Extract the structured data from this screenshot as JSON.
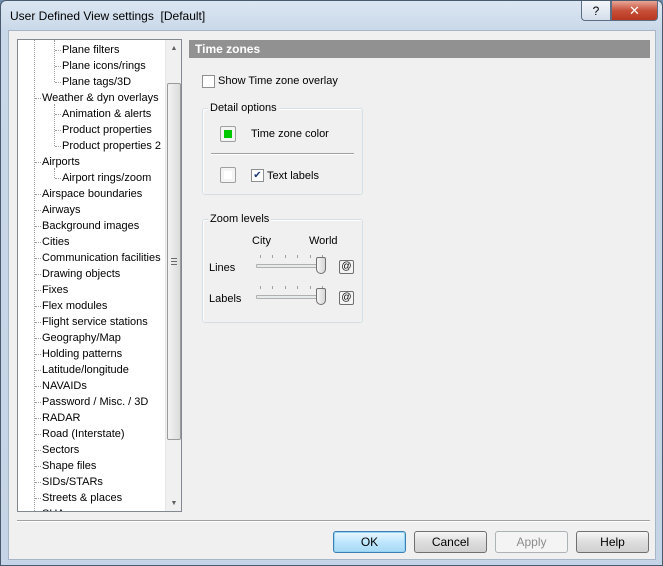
{
  "window": {
    "title": "User Defined View settings  [Default]",
    "help_label": "?",
    "close_label": "✕"
  },
  "tree": {
    "items": [
      {
        "label": "Plane filters",
        "level": 2
      },
      {
        "label": "Plane icons/rings",
        "level": 2
      },
      {
        "label": "Plane tags/3D",
        "level": 2
      },
      {
        "label": "Weather & dyn overlays",
        "level": 1
      },
      {
        "label": "Animation & alerts",
        "level": 2
      },
      {
        "label": "Product properties",
        "level": 2
      },
      {
        "label": "Product properties 2",
        "level": 2
      },
      {
        "label": "Airports",
        "level": 1
      },
      {
        "label": "Airport rings/zoom",
        "level": 2
      },
      {
        "label": "Airspace boundaries",
        "level": 1
      },
      {
        "label": "Airways",
        "level": 1
      },
      {
        "label": "Background images",
        "level": 1
      },
      {
        "label": "Cities",
        "level": 1
      },
      {
        "label": "Communication facilities",
        "level": 1
      },
      {
        "label": "Drawing objects",
        "level": 1
      },
      {
        "label": "Fixes",
        "level": 1
      },
      {
        "label": "Flex modules",
        "level": 1
      },
      {
        "label": "Flight service stations",
        "level": 1
      },
      {
        "label": "Geography/Map",
        "level": 1
      },
      {
        "label": "Holding patterns",
        "level": 1
      },
      {
        "label": "Latitude/longitude",
        "level": 1
      },
      {
        "label": "NAVAIDs",
        "level": 1
      },
      {
        "label": "Password / Misc. / 3D",
        "level": 1
      },
      {
        "label": "RADAR",
        "level": 1
      },
      {
        "label": "Road (Interstate)",
        "level": 1
      },
      {
        "label": "Sectors",
        "level": 1
      },
      {
        "label": "Shape files",
        "level": 1
      },
      {
        "label": "SIDs/STARs",
        "level": 1
      },
      {
        "label": "Streets & places",
        "level": 1
      },
      {
        "label": "SUAs",
        "level": 1
      }
    ],
    "scroll_up_icon": "▲",
    "scroll_down_icon": "▼"
  },
  "panel": {
    "header": "Time zones",
    "show_overlay_label": "Show Time zone overlay",
    "show_overlay_checked": false,
    "detail_options": {
      "title": "Detail options",
      "color_label": "Time zone color",
      "color_value": "#00c800",
      "text_labels_label": "Text labels",
      "text_labels_checked": true,
      "text_color_value": "#ffffff"
    },
    "zoom_levels": {
      "title": "Zoom levels",
      "min_label": "City",
      "max_label": "World",
      "rows": [
        {
          "label": "Lines",
          "value": 1.0,
          "button_label": "@"
        },
        {
          "label": "Labels",
          "value": 1.0,
          "button_label": "@"
        }
      ]
    }
  },
  "buttons": {
    "ok": "OK",
    "cancel": "Cancel",
    "apply": "Apply",
    "help": "Help"
  },
  "colors": {
    "header_bg": "#919191",
    "accent_green": "#00c800"
  }
}
